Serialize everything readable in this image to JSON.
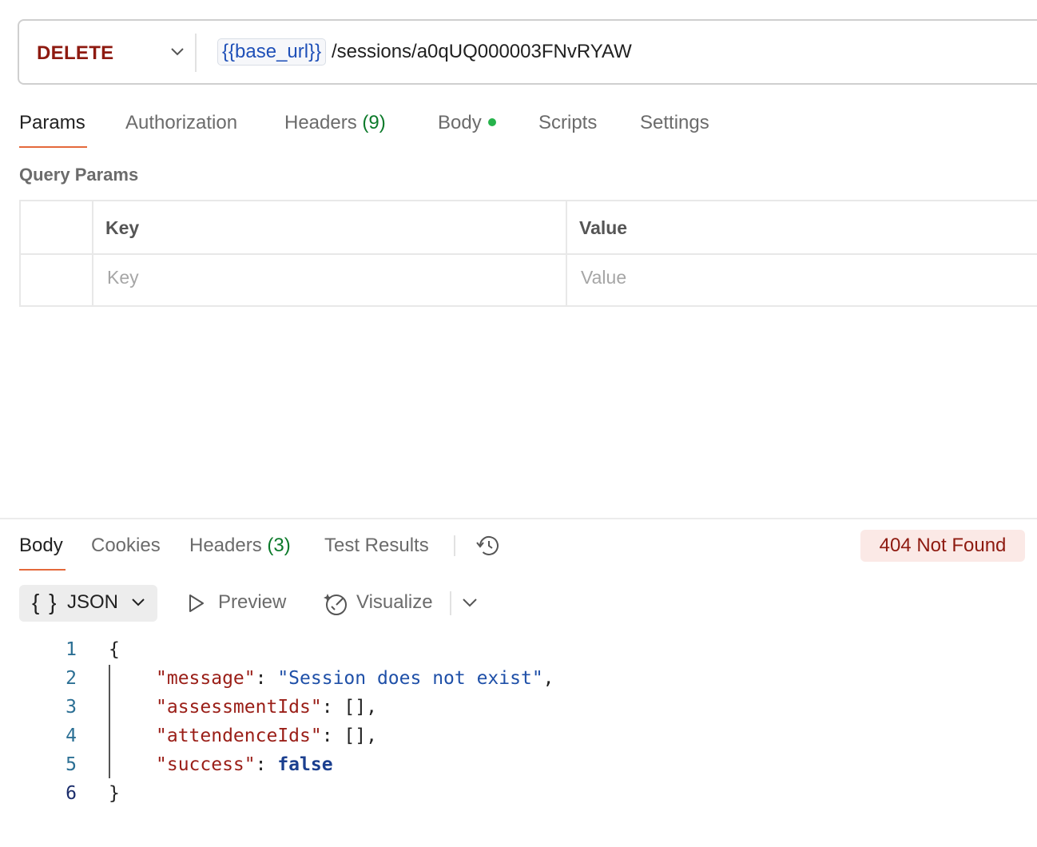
{
  "request": {
    "method": "DELETE",
    "url_variable": "{{base_url}}",
    "url_path": "/sessions/a0qUQ000003FNvRYAW"
  },
  "request_tabs": [
    {
      "label": "Params"
    },
    {
      "label": "Authorization"
    },
    {
      "label": "Headers",
      "count": "(9)"
    },
    {
      "label": "Body"
    },
    {
      "label": "Scripts"
    },
    {
      "label": "Settings"
    }
  ],
  "query_params": {
    "title": "Query Params",
    "key_header": "Key",
    "value_header": "Value",
    "key_placeholder": "Key",
    "value_placeholder": "Value"
  },
  "response_tabs": [
    {
      "label": "Body"
    },
    {
      "label": "Cookies"
    },
    {
      "label": "Headers",
      "count": "(3)"
    },
    {
      "label": "Test Results"
    }
  ],
  "status": "404 Not Found",
  "format_toolbar": {
    "format": "JSON",
    "braces": "{ }",
    "preview": "Preview",
    "visualize": "Visualize"
  },
  "response_body": {
    "line_numbers": [
      "1",
      "2",
      "3",
      "4",
      "5",
      "6"
    ],
    "open": "{",
    "close": "}",
    "fields": [
      {
        "key": "\"message\"",
        "sep": ": ",
        "value": "\"Session does not exist\"",
        "end": ","
      },
      {
        "key": "\"assessmentIds\"",
        "sep": ": ",
        "value": "[]",
        "end": ","
      },
      {
        "key": "\"attendenceIds\"",
        "sep": ": ",
        "value": "[]",
        "end": ","
      },
      {
        "key": "\"success\"",
        "sep": ": ",
        "value": "false",
        "end": ""
      }
    ]
  },
  "colors": {
    "method": "#8e1a10",
    "accent_underline": "#e4693b",
    "body_dot": "#26b34b",
    "status_bg": "#fbe9e6",
    "status_text": "#8e1a10"
  }
}
